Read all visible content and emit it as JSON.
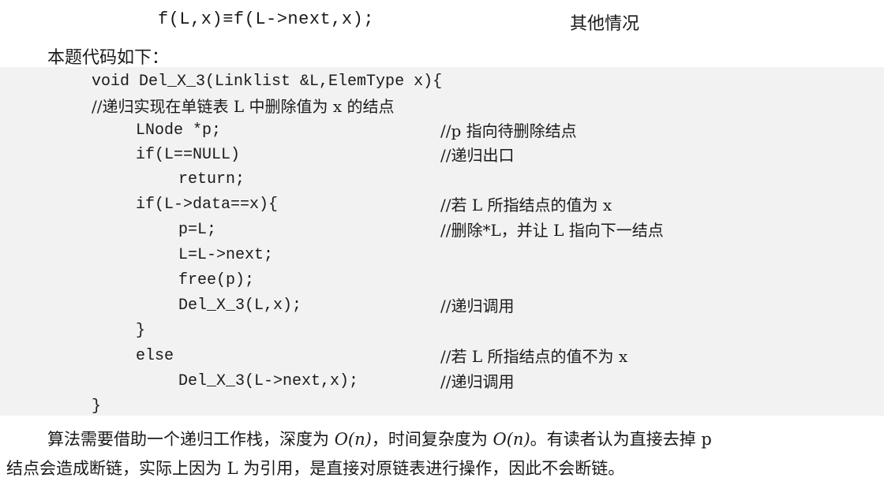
{
  "header": {
    "formula": "f(L,x)≡f(L->next,x);",
    "other_case": "其他情况"
  },
  "intro": "本题代码如下：",
  "code_lines": [
    {
      "code": "void Del_X_3(Linklist &L,ElemType x){",
      "comment": ""
    },
    {
      "code": "//递归实现在单链表 L 中删除值为 x 的结点",
      "comment": ""
    },
    {
      "code": "LNode *p;",
      "comment": "//p 指向待删除结点"
    },
    {
      "code": "if(L==NULL)",
      "comment": "//递归出口"
    },
    {
      "code": "return;",
      "comment": ""
    },
    {
      "code": "if(L->data==x){",
      "comment": "//若 L 所指结点的值为 x"
    },
    {
      "code": "p=L;",
      "comment": "//删除*L，并让 L 指向下一结点"
    },
    {
      "code": "L=L->next;",
      "comment": ""
    },
    {
      "code": "free(p);",
      "comment": ""
    },
    {
      "code": "Del_X_3(L,x);",
      "comment": "//递归调用"
    },
    {
      "code": "}",
      "comment": ""
    },
    {
      "code": "else",
      "comment": "//若 L 所指结点的值不为 x"
    },
    {
      "code": "Del_X_3(L->next,x);",
      "comment": "//递归调用"
    },
    {
      "code": "}",
      "comment": ""
    }
  ],
  "paragraph": {
    "line1_a": "算法需要借助一个递归工作栈，深度为 ",
    "on1": "O(n)",
    "line1_b": "，时间复杂度为 ",
    "on2": "O(n)",
    "line1_c": "。有读者认为直接去掉 p",
    "line2": "结点会造成断链，实际上因为 L 为引用，是直接对原链表进行操作，因此不会断链。"
  }
}
